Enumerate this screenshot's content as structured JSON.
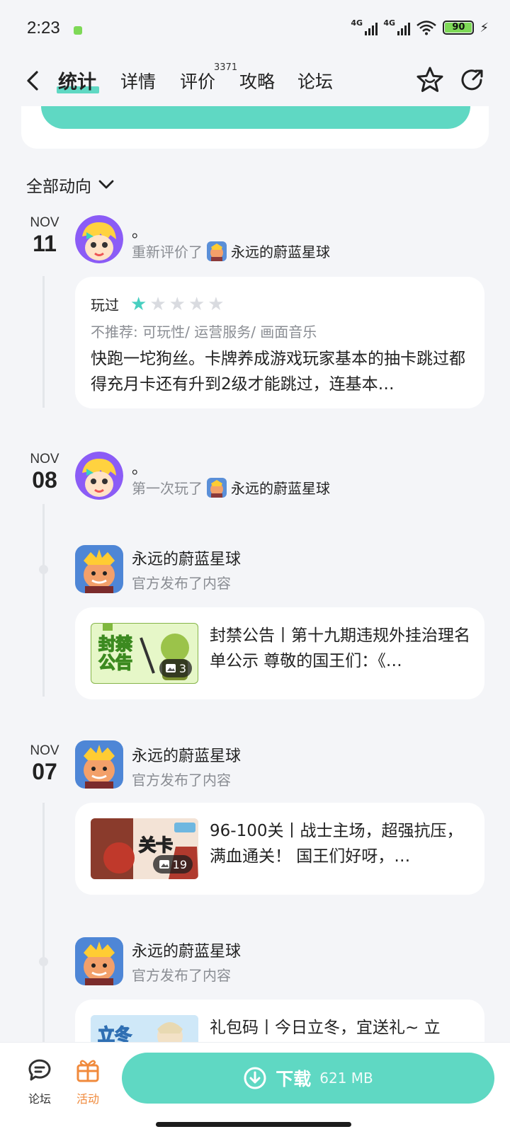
{
  "status": {
    "time": "2:23",
    "net1": "4G",
    "net2": "4G",
    "battery": "90"
  },
  "header": {
    "tabs": [
      {
        "label": "统计"
      },
      {
        "label": "详情"
      },
      {
        "label": "评价"
      },
      {
        "label": "攻略"
      },
      {
        "label": "论坛"
      }
    ],
    "review_count": "3371",
    "accent": "#5fd8c3"
  },
  "filter": {
    "label": "全部动向"
  },
  "entries": [
    {
      "month": "NOV",
      "day": "11",
      "user": "。",
      "action": "重新评价了",
      "game": "永远的蔚蓝星球",
      "review": {
        "status": "玩过",
        "rating": 1,
        "tags": "不推荐: 可玩性/ 运营服务/ 画面音乐",
        "text": "快跑一坨狗丝。卡牌养成游戏玩家基本的抽卡跳过都得充月卡还有升到2级才能跳过，连基本…"
      }
    },
    {
      "month": "NOV",
      "day": "08",
      "user": "。",
      "action": "第一次玩了",
      "game": "永远的蔚蓝星球"
    },
    {
      "publisher": "永远的蔚蓝星球",
      "action": "官方发布了内容",
      "post": {
        "thumb_text": "封禁公告",
        "img_count": "3",
        "text": "封禁公告丨第十九期违规外挂治理名单公示 尊敬的国王们：《…"
      }
    },
    {
      "month": "NOV",
      "day": "07",
      "publisher": "永远的蔚蓝星球",
      "action": "官方发布了内容",
      "post": {
        "thumb_text": "关卡",
        "img_count": "19",
        "text": "96-100关丨战士主场，超强抗压，满血通关！ 国王们好呀，…"
      }
    },
    {
      "publisher": "永远的蔚蓝星球",
      "action": "官方发布了内容",
      "post": {
        "thumb_text": "立冬",
        "text": "礼包码丨今日立冬，宜送礼~ 立"
      }
    }
  ],
  "bottom": {
    "forum_label": "论坛",
    "event_label": "活动",
    "download_label": "下载",
    "download_size": "621 MB"
  }
}
